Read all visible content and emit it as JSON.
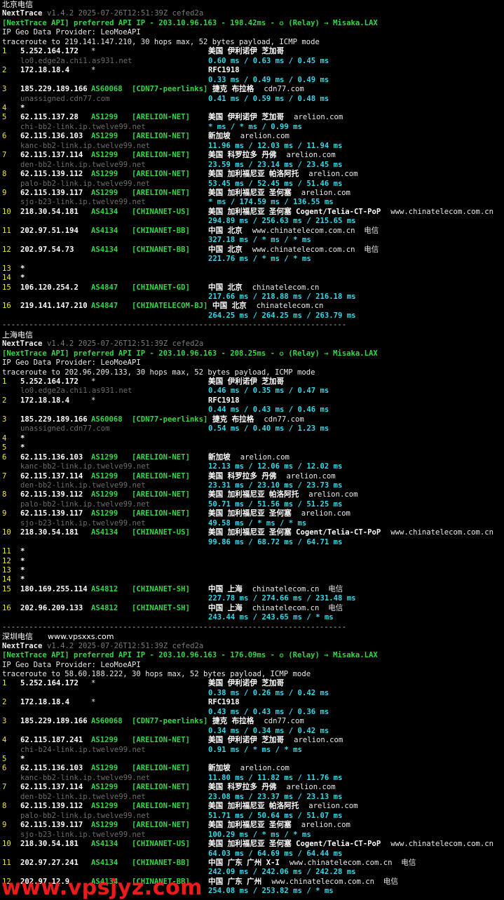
{
  "tool": {
    "name": "NextTrace",
    "version_line": "v1.4.2 2025-07-26T12:51:39Z cefed2a",
    "geo_provider_line": "IP Geo Data Provider: LeoMoeAPI"
  },
  "sections": [
    {
      "title": "北京电信",
      "title_extra": "",
      "api_line": "[NextTrace API] preferred API IP - 203.10.96.163 - 198.42ms - ✪ (Relay) → Misaka.LAX",
      "trace_line": "traceroute to 219.141.147.210, 30 hops max, 52 bytes payload, ICMP mode",
      "hops": [
        {
          "n": "1",
          "ip": "5.252.164.172",
          "as": "*",
          "tag": "",
          "geo": "美国 伊利诺伊 芝加哥",
          "dom": "",
          "host": "lo0.edge2a.chi1.as931.net",
          "rtt": "0.60 ms / 0.63 ms / 0.45 ms"
        },
        {
          "n": "2",
          "ip": "172.18.18.4",
          "as": "*",
          "tag": "",
          "geo": "RFC1918",
          "dom": "",
          "host": "",
          "rtt": "0.33 ms / 0.49 ms / 0.49 ms"
        },
        {
          "n": "3",
          "ip": "185.229.189.166",
          "as": "AS60068",
          "tag": "[CDN77-peerlinks]",
          "geo": "捷克 布拉格",
          "dom": "cdn77.com",
          "host": "unassigned.cdn77.com",
          "rtt": "0.41 ms / 0.59 ms / 0.48 ms"
        },
        {
          "n": "4",
          "ip": "*",
          "as": "",
          "tag": "",
          "geo": "",
          "dom": "",
          "host": "",
          "rtt": ""
        },
        {
          "n": "5",
          "ip": "62.115.137.28",
          "as": "AS1299",
          "tag": "[ARELION-NET]",
          "geo": "美国 伊利诺伊 芝加哥",
          "dom": "arelion.com",
          "host": "chi-bb2-link.ip.twelve99.net",
          "rtt": "* ms / * ms / 0.99 ms"
        },
        {
          "n": "6",
          "ip": "62.115.136.103",
          "as": "AS1299",
          "tag": "[ARELION-NET]",
          "geo": "新加坡",
          "dom": "arelion.com",
          "host": "kanc-bb2-link.ip.twelve99.net",
          "rtt": "11.96 ms / 12.03 ms / 11.94 ms"
        },
        {
          "n": "7",
          "ip": "62.115.137.114",
          "as": "AS1299",
          "tag": "[ARELION-NET]",
          "geo": "美国 科罗拉多 丹佛",
          "dom": "arelion.com",
          "host": "den-bb2-link.ip.twelve99.net",
          "rtt": "23.59 ms / 23.14 ms / 23.45 ms"
        },
        {
          "n": "8",
          "ip": "62.115.139.112",
          "as": "AS1299",
          "tag": "[ARELION-NET]",
          "geo": "美国 加利福尼亚 帕洛阿托",
          "dom": "arelion.com",
          "host": "palo-bb2-link.ip.twelve99.net",
          "rtt": "53.45 ms / 52.45 ms / 51.46 ms"
        },
        {
          "n": "9",
          "ip": "62.115.139.117",
          "as": "AS1299",
          "tag": "[ARELION-NET]",
          "geo": "美国 加利福尼亚 圣何塞",
          "dom": "arelion.com",
          "host": "sjo-b23-link.ip.twelve99.net",
          "rtt": "* ms / 174.59 ms / 136.55 ms"
        },
        {
          "n": "10",
          "ip": "218.30.54.181",
          "as": "AS4134",
          "tag": "[CHINANET-US]",
          "geo": "美国 加利福尼亚 圣何塞 Cogent/Telia-CT-PoP",
          "dom": "www.chinatelecom.com.cn",
          "host": "",
          "rtt": "294.89 ms / 256.63 ms / 215.65 ms"
        },
        {
          "n": "11",
          "ip": "202.97.51.194",
          "as": "AS4134",
          "tag": "[CHINANET-BB]",
          "geo": "中国 北京",
          "dom": "www.chinatelecom.com.cn  电信",
          "host": "",
          "rtt": "327.18 ms / * ms / * ms"
        },
        {
          "n": "12",
          "ip": "202.97.54.73",
          "as": "AS4134",
          "tag": "[CHINANET-BB]",
          "geo": "中国 北京",
          "dom": "www.chinatelecom.com.cn  电信",
          "host": "",
          "rtt": "221.76 ms / * ms / * ms"
        },
        {
          "n": "13",
          "ip": "*",
          "as": "",
          "tag": "",
          "geo": "",
          "dom": "",
          "host": "",
          "rtt": ""
        },
        {
          "n": "14",
          "ip": "*",
          "as": "",
          "tag": "",
          "geo": "",
          "dom": "",
          "host": "",
          "rtt": ""
        },
        {
          "n": "15",
          "ip": "106.120.254.2",
          "as": "AS4847",
          "tag": "[CHINANET-GD]",
          "geo": "中国 北京",
          "dom": "chinatelecom.cn",
          "host": "",
          "rtt": "217.66 ms / 218.88 ms / 216.18 ms"
        },
        {
          "n": "16",
          "ip": "219.141.147.210",
          "as": "AS4847",
          "tag": "[CHINATELECOM-BJ]",
          "geo": "中国 北京",
          "dom": "chinatelecom.cn",
          "host": "",
          "rtt": "264.25 ms / 264.25 ms / 263.79 ms"
        }
      ]
    },
    {
      "title": "上海电信",
      "title_extra": "",
      "api_line": "[NextTrace API] preferred API IP - 203.10.96.163 - 208.25ms - ✪ (Relay) → Misaka.LAX",
      "trace_line": "traceroute to 202.96.209.133, 30 hops max, 52 bytes payload, ICMP mode",
      "hops": [
        {
          "n": "1",
          "ip": "5.252.164.172",
          "as": "*",
          "tag": "",
          "geo": "美国 伊利诺伊 芝加哥",
          "dom": "",
          "host": "lo0.edge2a.chi1.as931.net",
          "rtt": "0.46 ms / 0.35 ms / 0.47 ms"
        },
        {
          "n": "2",
          "ip": "172.18.18.4",
          "as": "*",
          "tag": "",
          "geo": "RFC1918",
          "dom": "",
          "host": "",
          "rtt": "0.44 ms / 0.43 ms / 0.46 ms"
        },
        {
          "n": "3",
          "ip": "185.229.189.166",
          "as": "AS60068",
          "tag": "[CDN77-peerlinks]",
          "geo": "捷克 布拉格",
          "dom": "cdn77.com",
          "host": "unassigned.cdn77.com",
          "rtt": "0.54 ms / 0.40 ms / 1.23 ms"
        },
        {
          "n": "4",
          "ip": "*",
          "as": "",
          "tag": "",
          "geo": "",
          "dom": "",
          "host": "",
          "rtt": ""
        },
        {
          "n": "5",
          "ip": "*",
          "as": "",
          "tag": "",
          "geo": "",
          "dom": "",
          "host": "",
          "rtt": ""
        },
        {
          "n": "6",
          "ip": "62.115.136.103",
          "as": "AS1299",
          "tag": "[ARELION-NET]",
          "geo": "新加坡",
          "dom": "arelion.com",
          "host": "kanc-bb2-link.ip.twelve99.net",
          "rtt": "12.13 ms / 12.06 ms / 12.02 ms"
        },
        {
          "n": "7",
          "ip": "62.115.137.114",
          "as": "AS1299",
          "tag": "[ARELION-NET]",
          "geo": "美国 科罗拉多 丹佛",
          "dom": "arelion.com",
          "host": "den-bb2-link.ip.twelve99.net",
          "rtt": "23.31 ms / 23.10 ms / 23.73 ms"
        },
        {
          "n": "8",
          "ip": "62.115.139.112",
          "as": "AS1299",
          "tag": "[ARELION-NET]",
          "geo": "美国 加利福尼亚 帕洛阿托",
          "dom": "arelion.com",
          "host": "palo-bb2-link.ip.twelve99.net",
          "rtt": "50.71 ms / 51.56 ms / 51.25 ms"
        },
        {
          "n": "9",
          "ip": "62.115.139.117",
          "as": "AS1299",
          "tag": "[ARELION-NET]",
          "geo": "美国 加利福尼亚 圣何塞",
          "dom": "arelion.com",
          "host": "sjo-b23-link.ip.twelve99.net",
          "rtt": "49.58 ms / * ms / * ms"
        },
        {
          "n": "10",
          "ip": "218.30.54.181",
          "as": "AS4134",
          "tag": "[CHINANET-US]",
          "geo": "美国 加利福尼亚 圣何塞 Cogent/Telia-CT-PoP",
          "dom": "www.chinatelecom.com.cn",
          "host": "",
          "rtt": "99.86 ms / 68.72 ms / 64.71 ms"
        },
        {
          "n": "11",
          "ip": "*",
          "as": "",
          "tag": "",
          "geo": "",
          "dom": "",
          "host": "",
          "rtt": ""
        },
        {
          "n": "12",
          "ip": "*",
          "as": "",
          "tag": "",
          "geo": "",
          "dom": "",
          "host": "",
          "rtt": ""
        },
        {
          "n": "13",
          "ip": "*",
          "as": "",
          "tag": "",
          "geo": "",
          "dom": "",
          "host": "",
          "rtt": ""
        },
        {
          "n": "14",
          "ip": "*",
          "as": "",
          "tag": "",
          "geo": "",
          "dom": "",
          "host": "",
          "rtt": ""
        },
        {
          "n": "15",
          "ip": "180.169.255.114",
          "as": "AS4812",
          "tag": "[CHINANET-SH]",
          "geo": "中国 上海",
          "dom": "chinatelecom.cn  电信",
          "host": "",
          "rtt": "227.78 ms / 274.66 ms / 231.48 ms"
        },
        {
          "n": "16",
          "ip": "202.96.209.133",
          "as": "AS4812",
          "tag": "[CHINANET-SH]",
          "geo": "中国 上海",
          "dom": "chinatelecom.cn  电信",
          "host": "",
          "rtt": "243.44 ms / 243.65 ms / * ms"
        }
      ]
    },
    {
      "title": "深圳电信",
      "title_extra": "www.vpsxxs.com",
      "api_line": "[NextTrace API] preferred API IP - 203.10.96.163 - 176.09ms - ✪ (Relay) → Misaka.LAX",
      "trace_line": "traceroute to 58.60.188.222, 30 hops max, 52 bytes payload, ICMP mode",
      "hops": [
        {
          "n": "1",
          "ip": "5.252.164.172",
          "as": "*",
          "tag": "",
          "geo": "美国 伊利诺伊 芝加哥",
          "dom": "",
          "host": "",
          "rtt": "0.38 ms / 0.26 ms / 0.42 ms"
        },
        {
          "n": "2",
          "ip": "172.18.18.4",
          "as": "*",
          "tag": "",
          "geo": "RFC1918",
          "dom": "",
          "host": "",
          "rtt": "0.43 ms / 0.43 ms / 0.36 ms"
        },
        {
          "n": "3",
          "ip": "185.229.189.166",
          "as": "AS60068",
          "tag": "[CDN77-peerlinks]",
          "geo": "捷克 布拉格",
          "dom": "cdn77.com",
          "host": "",
          "rtt": "0.34 ms / 0.34 ms / 0.42 ms"
        },
        {
          "n": "4",
          "ip": "62.115.187.241",
          "as": "AS1299",
          "tag": "[ARELION-NET]",
          "geo": "美国 伊利诺伊 芝加哥",
          "dom": "arelion.com",
          "host": "chi-b24-link.ip.twelve99.net",
          "rtt": "0.91 ms / * ms / * ms"
        },
        {
          "n": "5",
          "ip": "*",
          "as": "",
          "tag": "",
          "geo": "",
          "dom": "",
          "host": "",
          "rtt": ""
        },
        {
          "n": "6",
          "ip": "62.115.136.103",
          "as": "AS1299",
          "tag": "[ARELION-NET]",
          "geo": "新加坡",
          "dom": "arelion.com",
          "host": "kanc-bb2-link.ip.twelve99.net",
          "rtt": "11.80 ms / 11.82 ms / 11.76 ms"
        },
        {
          "n": "7",
          "ip": "62.115.137.114",
          "as": "AS1299",
          "tag": "[ARELION-NET]",
          "geo": "美国 科罗拉多 丹佛",
          "dom": "arelion.com",
          "host": "den-bb2-link.ip.twelve99.net",
          "rtt": "23.08 ms / 23.37 ms / 23.13 ms"
        },
        {
          "n": "8",
          "ip": "62.115.139.112",
          "as": "AS1299",
          "tag": "[ARELION-NET]",
          "geo": "美国 加利福尼亚 帕洛阿托",
          "dom": "arelion.com",
          "host": "palo-bb2-link.ip.twelve99.net",
          "rtt": "51.71 ms / 50.64 ms / 51.07 ms"
        },
        {
          "n": "9",
          "ip": "62.115.139.117",
          "as": "AS1299",
          "tag": "[ARELION-NET]",
          "geo": "美国 加利福尼亚 圣何塞",
          "dom": "arelion.com",
          "host": "sjo-b23-link.ip.twelve99.net",
          "rtt": "100.29 ms / * ms / * ms"
        },
        {
          "n": "10",
          "ip": "218.30.54.181",
          "as": "AS4134",
          "tag": "[CHINANET-US]",
          "geo": "美国 加利福尼亚 圣何塞 Cogent/Telia-CT-PoP",
          "dom": "www.chinatelecom.com.cn",
          "host": "",
          "rtt": "64.03 ms / 64.69 ms / 64.44 ms"
        },
        {
          "n": "11",
          "ip": "202.97.27.241",
          "as": "AS4134",
          "tag": "[CHINANET-BB]",
          "geo": "中国 广东 广州 X-I",
          "dom": "www.chinatelecom.com.cn  电信",
          "host": "",
          "rtt": "242.09 ms / 242.06 ms / 242.28 ms"
        },
        {
          "n": "12",
          "ip": "202.97.12.9",
          "as": "AS4134",
          "tag": "[CHINANET-BB]",
          "geo": "中国 广东 广州",
          "dom": "www.chinatelecom.com.cn  电信",
          "host": "",
          "rtt": "254.08 ms / 253.82 ms / * ms"
        }
      ]
    }
  ],
  "separator": "-----------------------------------------------------------------------------",
  "watermark": "www.vpsjyz.com"
}
